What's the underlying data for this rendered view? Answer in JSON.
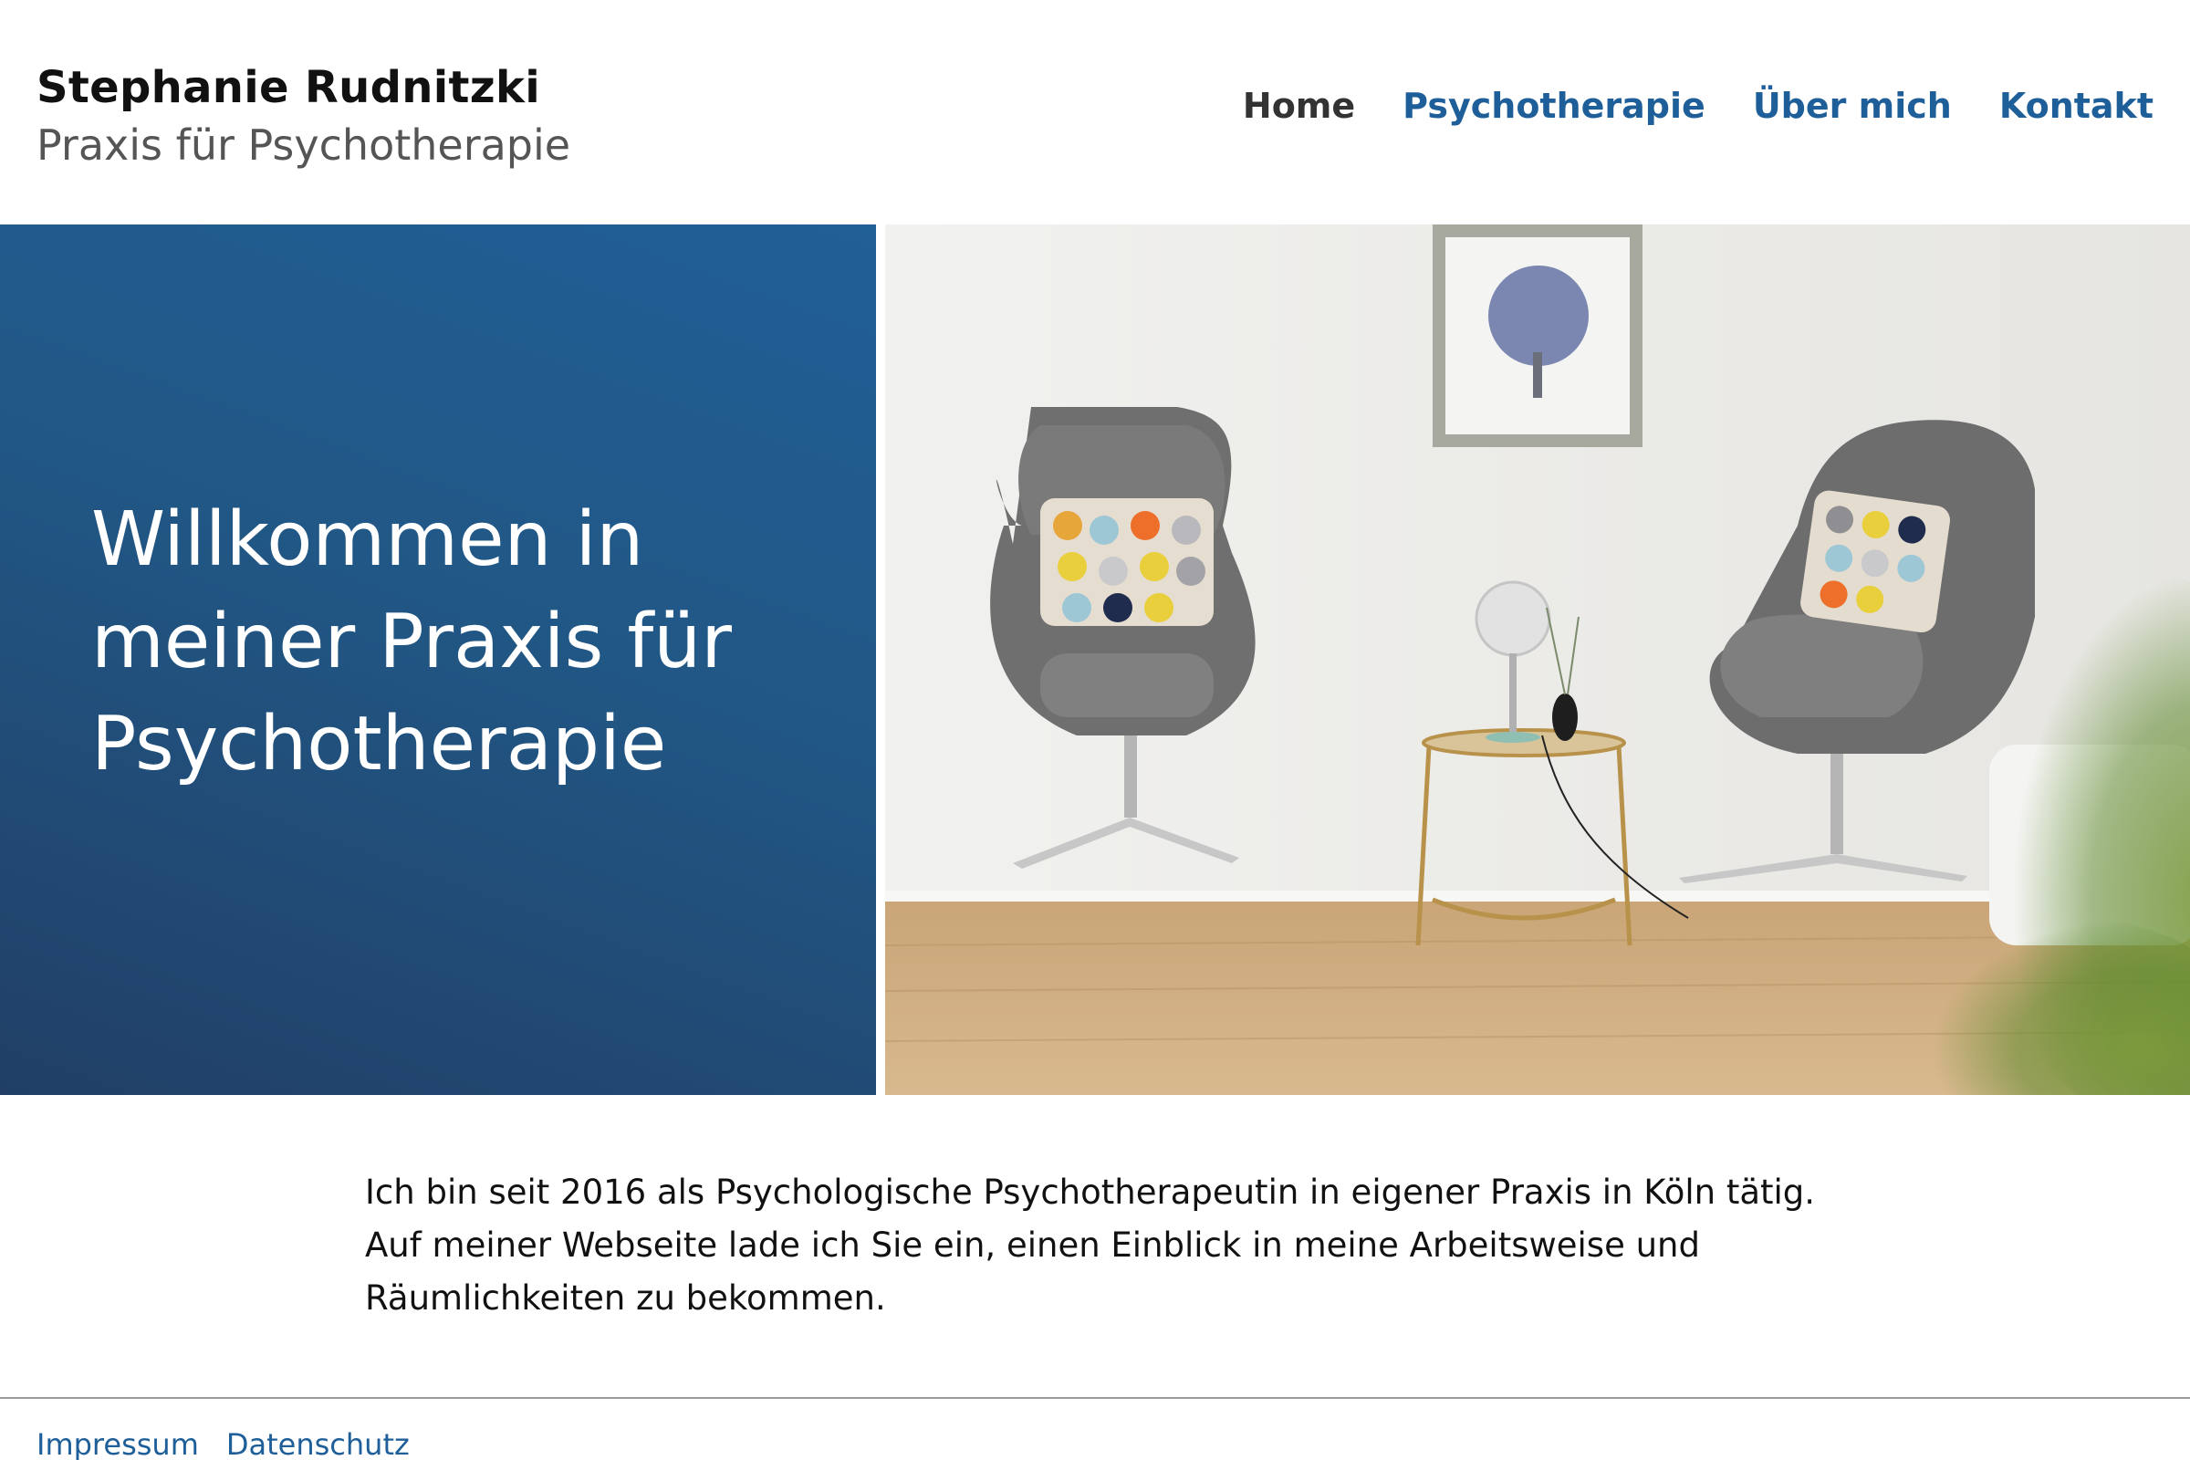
{
  "header": {
    "name": "Stephanie Rudnitzki",
    "subtitle": "Praxis für Psychotherapie"
  },
  "nav": {
    "items": [
      {
        "label": "Home",
        "active": true
      },
      {
        "label": "Psychotherapie",
        "active": false
      },
      {
        "label": "Über mich",
        "active": false
      },
      {
        "label": "Kontakt",
        "active": false
      }
    ]
  },
  "hero": {
    "title": "Willkommen in meiner Praxis für Psychotherapie"
  },
  "intro": {
    "text": "Ich bin seit 2016 als Psychologische Psychotherapeutin in eigener Praxis in Köln tätig. Auf meiner Webseite lade ich Sie ein, einen Einblick in meine Arbeitsweise und Räumlichkeiten zu bekommen."
  },
  "footer": {
    "links": [
      "Impressum",
      "Datenschutz"
    ]
  },
  "colors": {
    "accent": "#1f5f99",
    "hero_gradient_top": "#215f97",
    "hero_gradient_bottom": "#213f66",
    "nav_active": "#333333"
  }
}
